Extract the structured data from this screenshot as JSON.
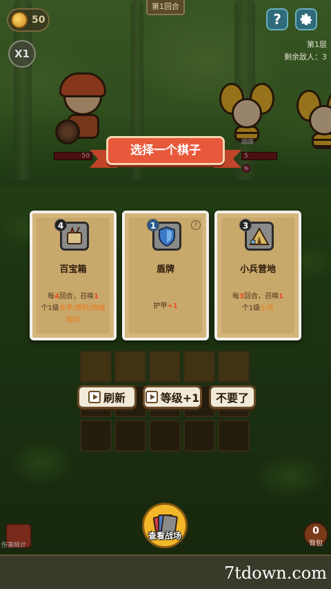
{
  "hud": {
    "coins": "50",
    "round": "第1回合",
    "speed": "X1",
    "help": "?",
    "floor": "第1层",
    "enemies_left": "剩余敌人：3"
  },
  "battle": {
    "hero_hp": "50",
    "enemy_name": "蝴蝶",
    "enemy_hp": "5",
    "enemy_status": "%"
  },
  "prompt": "选择一个棋子",
  "cards": [
    {
      "level": "4",
      "icon": "treasure-chest-icon",
      "title": "百宝箱",
      "desc_pre": "每",
      "desc_num1": "4",
      "desc_mid": "回合，召唤",
      "desc_num2": "1",
      "desc_mid2": "个1级",
      "desc_kw": "长矛/旗帜/残破短剑"
    },
    {
      "level": "1",
      "icon": "shield-icon",
      "info": "?",
      "title": "盾牌",
      "desc_pre": "护甲",
      "desc_num1": "+1"
    },
    {
      "level": "3",
      "icon": "tent-icon",
      "title": "小兵营地",
      "desc_pre": "每",
      "desc_num1": "3",
      "desc_mid": "回合，召唤",
      "desc_num2": "1",
      "desc_mid2": "个1级",
      "desc_kw": "小兵"
    }
  ],
  "actions": {
    "refresh": "刷新",
    "level_up": "等级+1",
    "skip": "不要了"
  },
  "bottom": {
    "view_battlefield": "查看战场",
    "damage_stats": "伤害统计",
    "bag_count": "0",
    "bag": "背包",
    "watermark": "7tdown.com"
  },
  "colors": {
    "ribbon": "#e8583a",
    "card": "#d4b57c",
    "accent_number": "#e84a1a",
    "keyword": "#e87a1a"
  }
}
